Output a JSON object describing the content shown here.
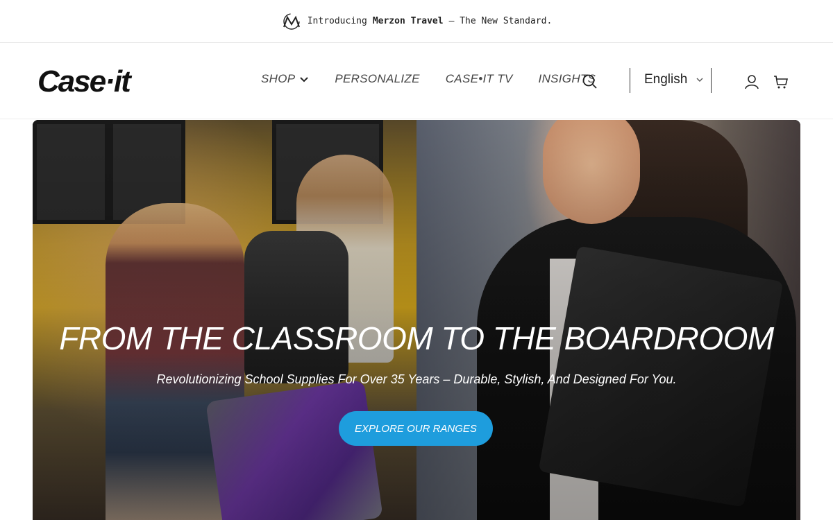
{
  "announcement": {
    "prefix": "Introducing",
    "brand": "Merzon Travel",
    "suffix": "– The New Standard.",
    "icon": "merzon-logo-mark"
  },
  "header": {
    "logo_text": "Case·it",
    "nav": [
      {
        "label": "SHOP",
        "has_dropdown": true
      },
      {
        "label": "PERSONALIZE",
        "has_dropdown": false
      },
      {
        "label": "CASE•IT TV",
        "has_dropdown": false
      },
      {
        "label": "INSIGHTS",
        "has_dropdown": false
      }
    ],
    "language": {
      "selected": "English"
    },
    "icons": [
      "search-icon",
      "account-icon",
      "cart-icon"
    ]
  },
  "hero": {
    "title": "FROM THE CLASSROOM TO THE BOARDROOM",
    "subtitle": "Revolutionizing School Supplies For Over 35 Years – Durable, Stylish, And Designed For You.",
    "cta_label": "EXPLORE OUR RANGES",
    "colors": {
      "cta": "#1e9ddd",
      "text": "#ffffff"
    }
  }
}
